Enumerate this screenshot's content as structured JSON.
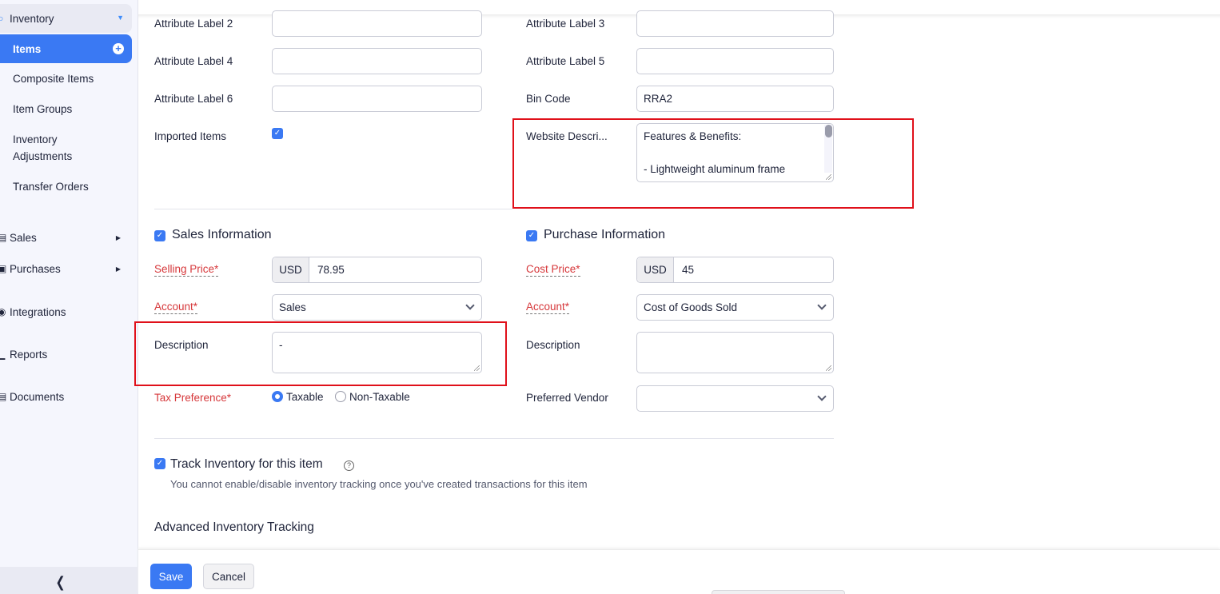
{
  "sidebar": {
    "group": {
      "label": "Inventory",
      "icon": "inventory-icon"
    },
    "active_item": {
      "label": "Items",
      "icon": "plus-circle-icon"
    },
    "sub_items": [
      {
        "label": "Composite Items"
      },
      {
        "label": "Item Groups"
      },
      {
        "label": "Inventory\nAdjustments"
      },
      {
        "label": "Transfer Orders"
      }
    ],
    "items": [
      {
        "label": "Sales",
        "icon": "cart-icon",
        "has_arrow": true
      },
      {
        "label": "Purchases",
        "icon": "bag-icon",
        "has_arrow": true
      },
      {
        "label": "Integrations",
        "icon": "integrations-icon",
        "has_arrow": false
      },
      {
        "label": "Reports",
        "icon": "reports-icon",
        "has_arrow": false
      },
      {
        "label": "Documents",
        "icon": "documents-icon",
        "has_arrow": false
      }
    ],
    "collapse_icon": "chevron-left-icon"
  },
  "attributes": {
    "label2": "Attribute Label 2",
    "value2": "",
    "label3": "Attribute Label 3",
    "value3": "",
    "label4": "Attribute Label 4",
    "value4": "",
    "label5": "Attribute Label 5",
    "value5": "",
    "label6": "Attribute Label 6",
    "value6": "",
    "bin_code_label": "Bin Code",
    "bin_code_value": "RRA2",
    "imported_label": "Imported Items",
    "imported_checked": true,
    "website_desc_label": "Website Descri...",
    "website_desc_line1": "Features & Benefits:",
    "website_desc_line2": "",
    "website_desc_line3": "- Lightweight aluminum frame"
  },
  "sales": {
    "title": "Sales Information",
    "checked": true,
    "price_label": "Selling Price*",
    "currency": "USD",
    "price_value": "78.95",
    "account_label": "Account*",
    "account_value": "Sales",
    "description_label": "Description",
    "description_value": "-",
    "tax_label": "Tax Preference*",
    "tax_options": [
      {
        "label": "Taxable",
        "selected": true
      },
      {
        "label": "Non-Taxable",
        "selected": false
      }
    ]
  },
  "purchase": {
    "title": "Purchase Information",
    "checked": true,
    "price_label": "Cost Price*",
    "currency": "USD",
    "price_value": "45",
    "account_label": "Account*",
    "account_value": "Cost of Goods Sold",
    "description_label": "Description",
    "description_value": "",
    "vendor_label": "Preferred Vendor",
    "vendor_value": ""
  },
  "inventory": {
    "track_label": "Track Inventory for this item",
    "track_checked": true,
    "track_hint": "You cannot enable/disable inventory tracking once you've created transactions for this item",
    "advanced_title": "Advanced Inventory Tracking"
  },
  "footer": {
    "save_label": "Save",
    "cancel_label": "Cancel"
  },
  "colors": {
    "accent": "#3a79f3",
    "required": "#d6373a",
    "highlight_box": "#e0101a",
    "sidebar_bg": "#f5f6fd"
  }
}
